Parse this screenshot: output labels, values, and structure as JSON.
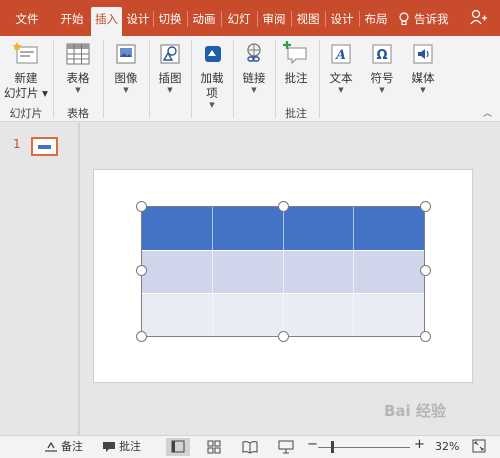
{
  "tabs": [
    {
      "label": "文件",
      "active": false
    },
    {
      "label": "开始",
      "active": false
    },
    {
      "label": "插入",
      "active": true
    },
    {
      "label": "设计",
      "active": false
    },
    {
      "label": "切换",
      "active": false
    },
    {
      "label": "动画",
      "active": false
    },
    {
      "label": "幻灯",
      "active": false
    },
    {
      "label": "审阅",
      "active": false
    },
    {
      "label": "视图",
      "active": false
    },
    {
      "label": "设计",
      "active": false
    },
    {
      "label": "布局",
      "active": false
    }
  ],
  "tell_me": "告诉我",
  "ribbon": {
    "new_slide": {
      "line1": "新建",
      "line2": "幻灯片"
    },
    "table": "表格",
    "image": "图像",
    "illustration": "插图",
    "addin": {
      "line1": "加载",
      "line2": "项"
    },
    "link": "链接",
    "comment": "批注",
    "text": "文本",
    "symbol": "符号",
    "media": "媒体",
    "groups": {
      "slides": "幻灯片",
      "tables": "表格",
      "comments": "批注"
    }
  },
  "slide_panel": {
    "slide_number": "1"
  },
  "status": {
    "notes": "备注",
    "comments": "批注",
    "zoom": "32%"
  },
  "colors": {
    "accent": "#c84b2b",
    "table_header": "#4472c4",
    "table_band1": "#cfd5ea",
    "table_band2": "#e9ebf5"
  },
  "watermark": "Bai 经验"
}
